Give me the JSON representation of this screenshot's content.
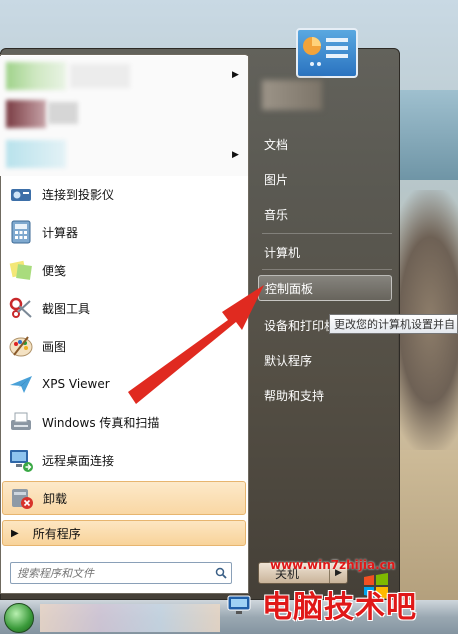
{
  "start_menu": {
    "programs": [
      {
        "name": "projector",
        "label": "连接到投影仪",
        "icon": "projector-icon"
      },
      {
        "name": "calculator",
        "label": "计算器",
        "icon": "calculator-icon"
      },
      {
        "name": "sticky-notes",
        "label": "便笺",
        "icon": "sticky-notes-icon"
      },
      {
        "name": "snipping-tool",
        "label": "截图工具",
        "icon": "scissors-icon"
      },
      {
        "name": "paint",
        "label": "画图",
        "icon": "palette-icon"
      },
      {
        "name": "xps-viewer",
        "label": "XPS Viewer",
        "icon": "xps-icon"
      },
      {
        "name": "fax-scan",
        "label": "Windows 传真和扫描",
        "icon": "fax-icon"
      },
      {
        "name": "remote-desktop",
        "label": "远程桌面连接",
        "icon": "remote-desktop-icon"
      }
    ],
    "uninstall_label": "卸载",
    "all_programs_label": "所有程序",
    "search_placeholder": "搜索程序和文件",
    "right_items": {
      "documents": "文档",
      "pictures": "图片",
      "music": "音乐",
      "computer": "计算机",
      "control_panel": "控制面板",
      "devices": "设备和打印机",
      "default_programs": "默认程序",
      "help": "帮助和支持"
    },
    "tooltip": "更改您的计算机设置并自",
    "shutdown_label": "关机"
  },
  "watermark": {
    "text": "电脑技术吧",
    "url": "www.win7zhijia.cn"
  },
  "colors": {
    "highlight": "#f9d7a4",
    "arrow": "#e02a20",
    "watermark": "#e01818"
  }
}
